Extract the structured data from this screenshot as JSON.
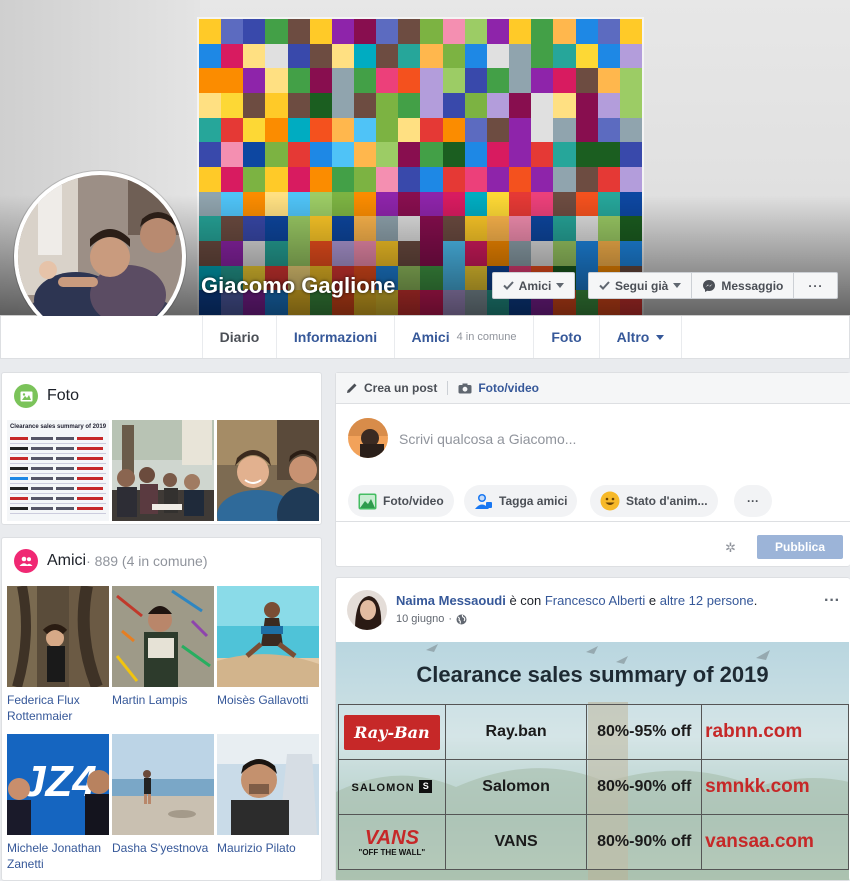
{
  "profile": {
    "name": "Giacomo Gaglione"
  },
  "cover_buttons": {
    "friends": "Amici",
    "following": "Segui già",
    "message": "Messaggio",
    "more": "···"
  },
  "tabs": [
    {
      "label": "Diario",
      "sub": ""
    },
    {
      "label": "Informazioni",
      "sub": ""
    },
    {
      "label": "Amici",
      "sub": "4 in comune"
    },
    {
      "label": "Foto",
      "sub": ""
    },
    {
      "label": "Altro",
      "sub": ""
    }
  ],
  "photos_card": {
    "title": "Foto",
    "thumb1": {
      "title": "Clearance sales summary of 2019"
    }
  },
  "friends_card": {
    "title": "Amici",
    "count": " · 889 (4 in comune)",
    "friends": [
      {
        "name": "Federica Flux Rottenmaier"
      },
      {
        "name": "Martin Lampis"
      },
      {
        "name": "Moisès Gallavotti"
      },
      {
        "name": "Michele Jonathan Zanetti"
      },
      {
        "name": "Dasha S'yestnova"
      },
      {
        "name": "Maurizio Pilato"
      }
    ]
  },
  "composer": {
    "create_post": "Crea un post",
    "photo_video": "Foto/video",
    "placeholder": "Scrivi qualcosa a Giacomo...",
    "actions": [
      "Foto/video",
      "Tagga amici",
      "Stato d'anim..."
    ],
    "more": "···",
    "publish": "Pubblica"
  },
  "post": {
    "author": "Naima Messaoudi",
    "with_text": " è con ",
    "tagged": "Francesco Alberti",
    "and_text": " e ",
    "others": "altre 12 persone",
    "period": ".",
    "date": "10 giugno",
    "menu": "···",
    "ad": {
      "title": "Clearance sales summary of 2019",
      "rows": [
        {
          "brand_logo": "Ray-Ban",
          "brand": "Ray.ban",
          "discount": "80%-95% off",
          "site": "rabnn.com"
        },
        {
          "brand_logo": "SALOMON",
          "brand": "Salomon",
          "discount": "80%-90% off",
          "site": "smnkk.com"
        },
        {
          "brand_logo": "VANS",
          "brand_logo_sub": "\"OFF THE WALL\"",
          "brand": "VANS",
          "discount": "80%-90% off",
          "site": "vansaa.com"
        }
      ]
    }
  }
}
